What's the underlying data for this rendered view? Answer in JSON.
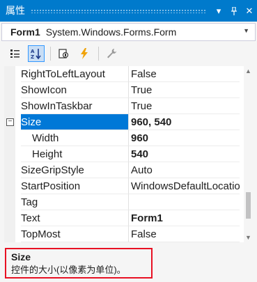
{
  "panel": {
    "title": "属性",
    "dropdown_glyph": "▾",
    "pin_glyph": "✚",
    "close_glyph": "✕"
  },
  "object_selector": {
    "name": "Form1",
    "type": "System.Windows.Forms.Form"
  },
  "toolbar": {
    "items": [
      {
        "icon": "categorized-icon",
        "active": false
      },
      {
        "icon": "alphabetical-icon",
        "active": true
      },
      {
        "icon": "properties-icon",
        "active": false
      },
      {
        "icon": "events-lightning-icon",
        "active": false
      },
      {
        "icon": "property-pages-wrench-icon",
        "active": false
      }
    ]
  },
  "properties": [
    {
      "name": "RightToLeftLayout",
      "value": "False"
    },
    {
      "name": "ShowIcon",
      "value": "True"
    },
    {
      "name": "ShowInTaskbar",
      "value": "True"
    },
    {
      "name": "Size",
      "value": "960, 540",
      "selected": true,
      "expanded": true,
      "expander": "⊟"
    },
    {
      "name": "Width",
      "value": "960",
      "sub": true
    },
    {
      "name": "Height",
      "value": "540",
      "sub": true
    },
    {
      "name": "SizeGripStyle",
      "value": "Auto"
    },
    {
      "name": "StartPosition",
      "value": "WindowsDefaultLocation"
    },
    {
      "name": "Tag",
      "value": ""
    },
    {
      "name": "Text",
      "value": "Form1",
      "bold": true
    },
    {
      "name": "TopMost",
      "value": "False"
    }
  ],
  "description": {
    "title": "Size",
    "text": "控件的大小(以像素为单位)。"
  },
  "colors": {
    "title_bar": "#007acc",
    "selection": "#0078d7",
    "highlight_border": "#e81123"
  }
}
